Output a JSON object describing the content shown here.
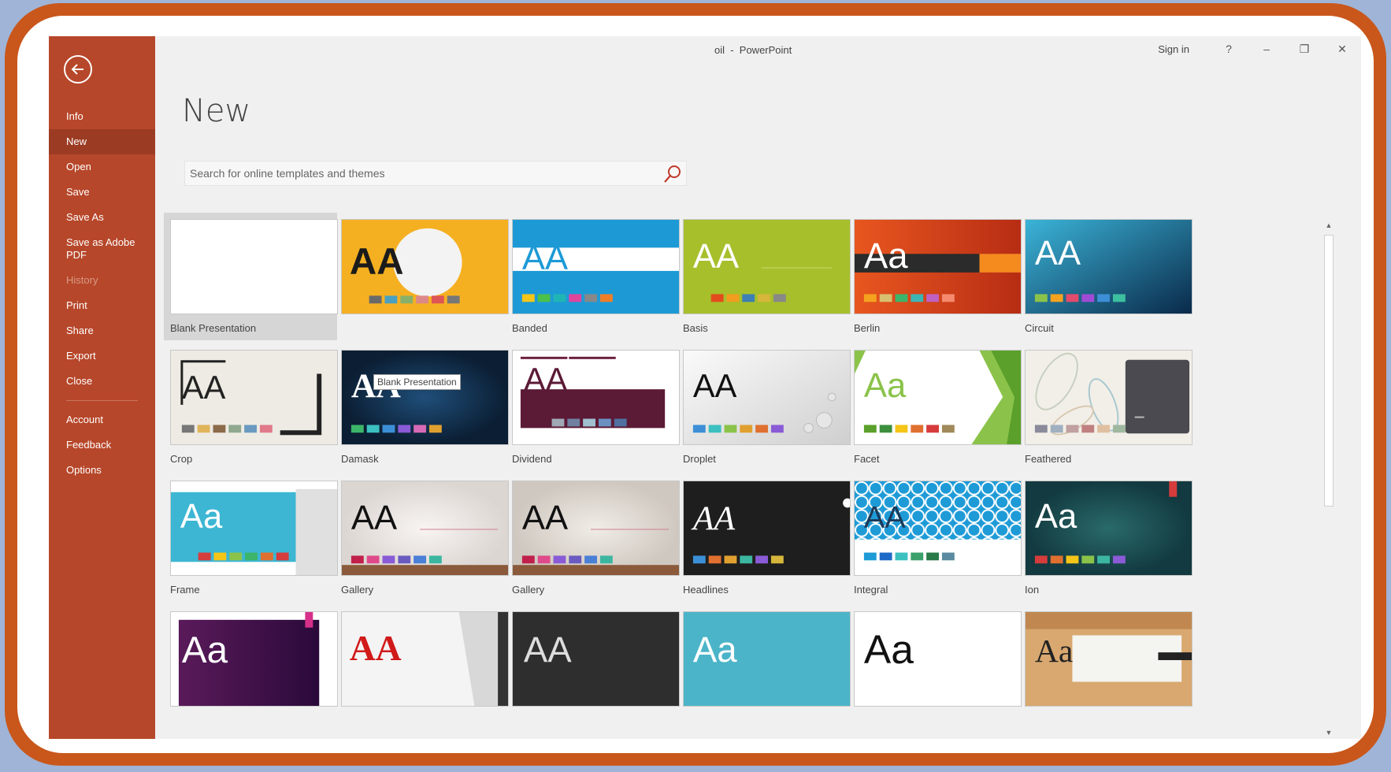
{
  "window": {
    "title": "oil  -  PowerPoint",
    "sign_in": "Sign in",
    "help": "?",
    "minimize": "–",
    "restore": "❐",
    "close": "✕"
  },
  "sidebar": {
    "items": [
      {
        "label": "Info"
      },
      {
        "label": "New"
      },
      {
        "label": "Open"
      },
      {
        "label": "Save"
      },
      {
        "label": "Save As"
      },
      {
        "label": "Save as Adobe PDF"
      },
      {
        "label": "History"
      },
      {
        "label": "Print"
      },
      {
        "label": "Share"
      },
      {
        "label": "Export"
      },
      {
        "label": "Close"
      },
      {
        "label": "Account"
      },
      {
        "label": "Feedback"
      },
      {
        "label": "Options"
      }
    ],
    "active": "New",
    "disabled": "History"
  },
  "main": {
    "title": "New",
    "search": {
      "placeholder": "Search for online templates and themes"
    },
    "tooltip": "Blank Presentation",
    "templates": [
      {
        "label": "Blank Presentation"
      },
      {
        "label": ""
      },
      {
        "label": "Banded"
      },
      {
        "label": "Basis"
      },
      {
        "label": "Berlin"
      },
      {
        "label": "Circuit"
      },
      {
        "label": "Crop"
      },
      {
        "label": "Damask"
      },
      {
        "label": "Dividend"
      },
      {
        "label": "Droplet"
      },
      {
        "label": "Facet"
      },
      {
        "label": "Feathered"
      },
      {
        "label": "Frame"
      },
      {
        "label": "Gallery"
      },
      {
        "label": "Gallery"
      },
      {
        "label": "Headlines"
      },
      {
        "label": "Integral"
      },
      {
        "label": "Ion"
      },
      {
        "label": ""
      },
      {
        "label": ""
      },
      {
        "label": ""
      },
      {
        "label": ""
      },
      {
        "label": ""
      },
      {
        "label": ""
      }
    ],
    "thumb_text": {
      "AA": "AA",
      "Aa": "Aa"
    }
  },
  "colors": {
    "sidebar": "#b7472a",
    "sidebar_active": "#9c3b23",
    "background": "#f0f0f0"
  }
}
